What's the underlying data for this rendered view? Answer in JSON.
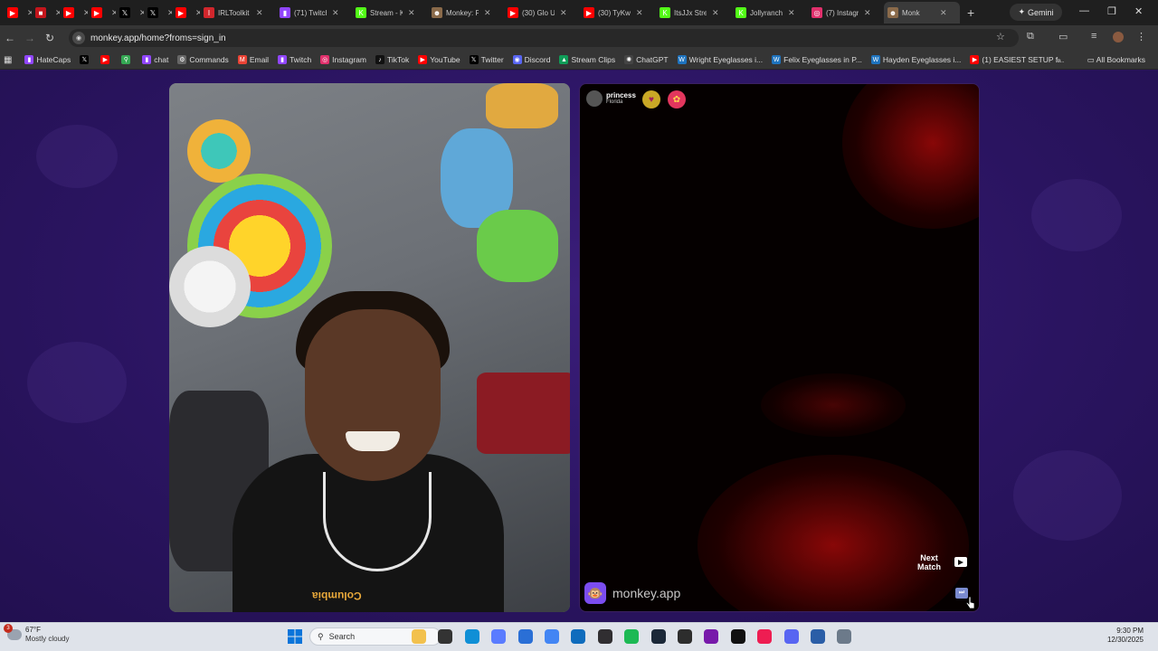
{
  "browser": {
    "tabs": [
      {
        "label": "",
        "icon": "youtube-icon",
        "color": "#ff0000"
      },
      {
        "label": "",
        "icon": "red-square-icon",
        "color": "#c4161c"
      },
      {
        "label": "",
        "icon": "youtube-icon",
        "color": "#ff0000"
      },
      {
        "label": "",
        "icon": "youtube-icon",
        "color": "#ff0000"
      },
      {
        "label": "",
        "icon": "x-icon",
        "color": "#000000"
      },
      {
        "label": "",
        "icon": "x-icon",
        "color": "#000000"
      },
      {
        "label": "",
        "icon": "youtube-icon",
        "color": "#ff0000"
      },
      {
        "label": "IRLToolkit",
        "icon": "irltoolkit-icon",
        "color": "#d1262c"
      },
      {
        "label": "(71) Twitch",
        "icon": "twitch-icon",
        "color": "#9146ff"
      },
      {
        "label": "Stream - K",
        "icon": "kick-icon",
        "color": "#53fc18"
      },
      {
        "label": "Monkey: F",
        "icon": "monkey-icon",
        "color": "#8a6a4a"
      },
      {
        "label": "(30) Glo U",
        "icon": "youtube-icon",
        "color": "#ff0000"
      },
      {
        "label": "(30) TyKw",
        "icon": "youtube-icon",
        "color": "#ff0000"
      },
      {
        "label": "ItsJJx Stre",
        "icon": "kick-icon",
        "color": "#53fc18"
      },
      {
        "label": "Jollyranch",
        "icon": "kick-icon",
        "color": "#53fc18"
      },
      {
        "label": "(7) Instagr",
        "icon": "instagram-icon",
        "color": "#e1306c"
      },
      {
        "label": "Monk",
        "icon": "monkey-icon",
        "color": "#8a6a4a",
        "active": true
      }
    ],
    "new_tab": "+",
    "gemini_label": "Gemini",
    "url": "monkey.app/home?froms=sign_in",
    "bookmarks": [
      {
        "label": "HateCaps",
        "icon": "twitch-icon",
        "color": "#9146ff"
      },
      {
        "label": "",
        "icon": "x-icon",
        "color": "#000000"
      },
      {
        "label": "",
        "icon": "youtube-icon",
        "color": "#ff0000"
      },
      {
        "label": "",
        "icon": "maps-icon",
        "color": "#34a853"
      },
      {
        "label": "chat",
        "icon": "twitch-icon",
        "color": "#9146ff"
      },
      {
        "label": "Commands",
        "icon": "gear-icon",
        "color": "#666666"
      },
      {
        "label": "Email",
        "icon": "gmail-icon",
        "color": "#ea4335"
      },
      {
        "label": "Twitch",
        "icon": "twitch-icon",
        "color": "#9146ff"
      },
      {
        "label": "Instagram",
        "icon": "instagram-icon",
        "color": "#e1306c"
      },
      {
        "label": "TikTok",
        "icon": "tiktok-icon",
        "color": "#111111"
      },
      {
        "label": "YouTube",
        "icon": "youtube-icon",
        "color": "#ff0000"
      },
      {
        "label": "Twitter",
        "icon": "x-icon",
        "color": "#000000"
      },
      {
        "label": "Discord",
        "icon": "discord-icon",
        "color": "#5865f2"
      },
      {
        "label": "Stream Clips",
        "icon": "drive-icon",
        "color": "#0f9d58"
      },
      {
        "label": "ChatGPT",
        "icon": "chatgpt-icon",
        "color": "#444444"
      },
      {
        "label": "Wright Eyeglasses i...",
        "icon": "wp-icon",
        "color": "#1e73be"
      },
      {
        "label": "Felix Eyeglasses in P...",
        "icon": "wp-icon",
        "color": "#1e73be"
      },
      {
        "label": "Hayden Eyeglasses i...",
        "icon": "wp-icon",
        "color": "#1e73be"
      },
      {
        "label": "(1) EASIEST SETUP f...",
        "icon": "youtube-icon",
        "color": "#ff0000"
      }
    ],
    "more_bookmarks": "»",
    "all_bookmarks": "All Bookmarks"
  },
  "monkey": {
    "partner_name": "princess",
    "partner_location": "Florida",
    "next_match_line1": "Next",
    "next_match_line2": "Match",
    "brand": "monkey.app",
    "shirt_text": "Columbia"
  },
  "taskbar": {
    "weather_temp": "67°F",
    "weather_desc": "Mostly cloudy",
    "weather_badge": "3",
    "search_placeholder": "Search",
    "time": "9:30 PM",
    "date": "12/30/2025",
    "apps": [
      {
        "icon": "file-explorer-icon",
        "color": "#f2c14e"
      },
      {
        "icon": "taskview-icon",
        "color": "#333333"
      },
      {
        "icon": "edge-icon",
        "color": "#0f8fd6"
      },
      {
        "icon": "copilot-icon",
        "color": "#5a7cff"
      },
      {
        "icon": "store-icon",
        "color": "#2a6fd6"
      },
      {
        "icon": "chrome-icon",
        "color": "#4285f4"
      },
      {
        "icon": "outlook-icon",
        "color": "#0f6cbd"
      },
      {
        "icon": "obs-icon",
        "color": "#302e31"
      },
      {
        "icon": "spotify-icon",
        "color": "#1db954"
      },
      {
        "icon": "steam-icon",
        "color": "#1b2838"
      },
      {
        "icon": "xbox-icon",
        "color": "#2d2d2d"
      },
      {
        "icon": "onenote-icon",
        "color": "#7719aa"
      },
      {
        "icon": "capcut-icon",
        "color": "#111111"
      },
      {
        "icon": "tiktok-icon",
        "color": "#ee1d52"
      },
      {
        "icon": "discord-icon",
        "color": "#5865f2"
      },
      {
        "icon": "remote-desktop-icon",
        "color": "#2b5ea7"
      },
      {
        "icon": "settings-icon",
        "color": "#6c7a8a"
      }
    ]
  }
}
